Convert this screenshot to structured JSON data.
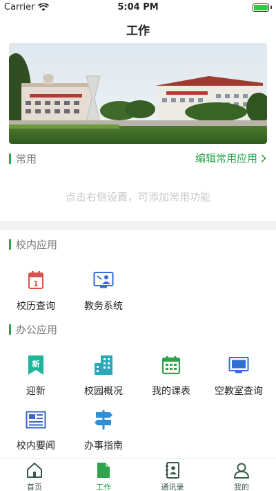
{
  "status_bar": {
    "carrier": "Carrier",
    "time": "5:04 PM"
  },
  "nav": {
    "title": "工作"
  },
  "common": {
    "label": "常用",
    "edit_link": "编辑常用应用",
    "empty_hint": "点击右侧设置，可添加常用功能"
  },
  "campus": {
    "label": "校内应用",
    "apps": [
      {
        "label": "校历查询",
        "icon": "calendar-icon"
      },
      {
        "label": "教务系统",
        "icon": "monitor-teacher-icon"
      }
    ]
  },
  "office": {
    "label": "办公应用",
    "apps": [
      {
        "label": "迎新",
        "icon": "new-bookmark-icon"
      },
      {
        "label": "校园概况",
        "icon": "buildings-icon"
      },
      {
        "label": "我的课表",
        "icon": "schedule-icon"
      },
      {
        "label": "空教室查询",
        "icon": "empty-classroom-icon"
      },
      {
        "label": "校内要闻",
        "icon": "newspaper-icon"
      },
      {
        "label": "办事指南",
        "icon": "signpost-icon"
      }
    ]
  },
  "tabbar": {
    "items": [
      {
        "label": "首页",
        "icon": "home-icon"
      },
      {
        "label": "工作",
        "icon": "document-icon"
      },
      {
        "label": "通讯录",
        "icon": "contacts-icon"
      },
      {
        "label": "我的",
        "icon": "user-icon"
      }
    ],
    "active_index": 1
  },
  "colors": {
    "accent": "#2fa24c",
    "hint": "#c8c8c8",
    "label": "#777777"
  }
}
